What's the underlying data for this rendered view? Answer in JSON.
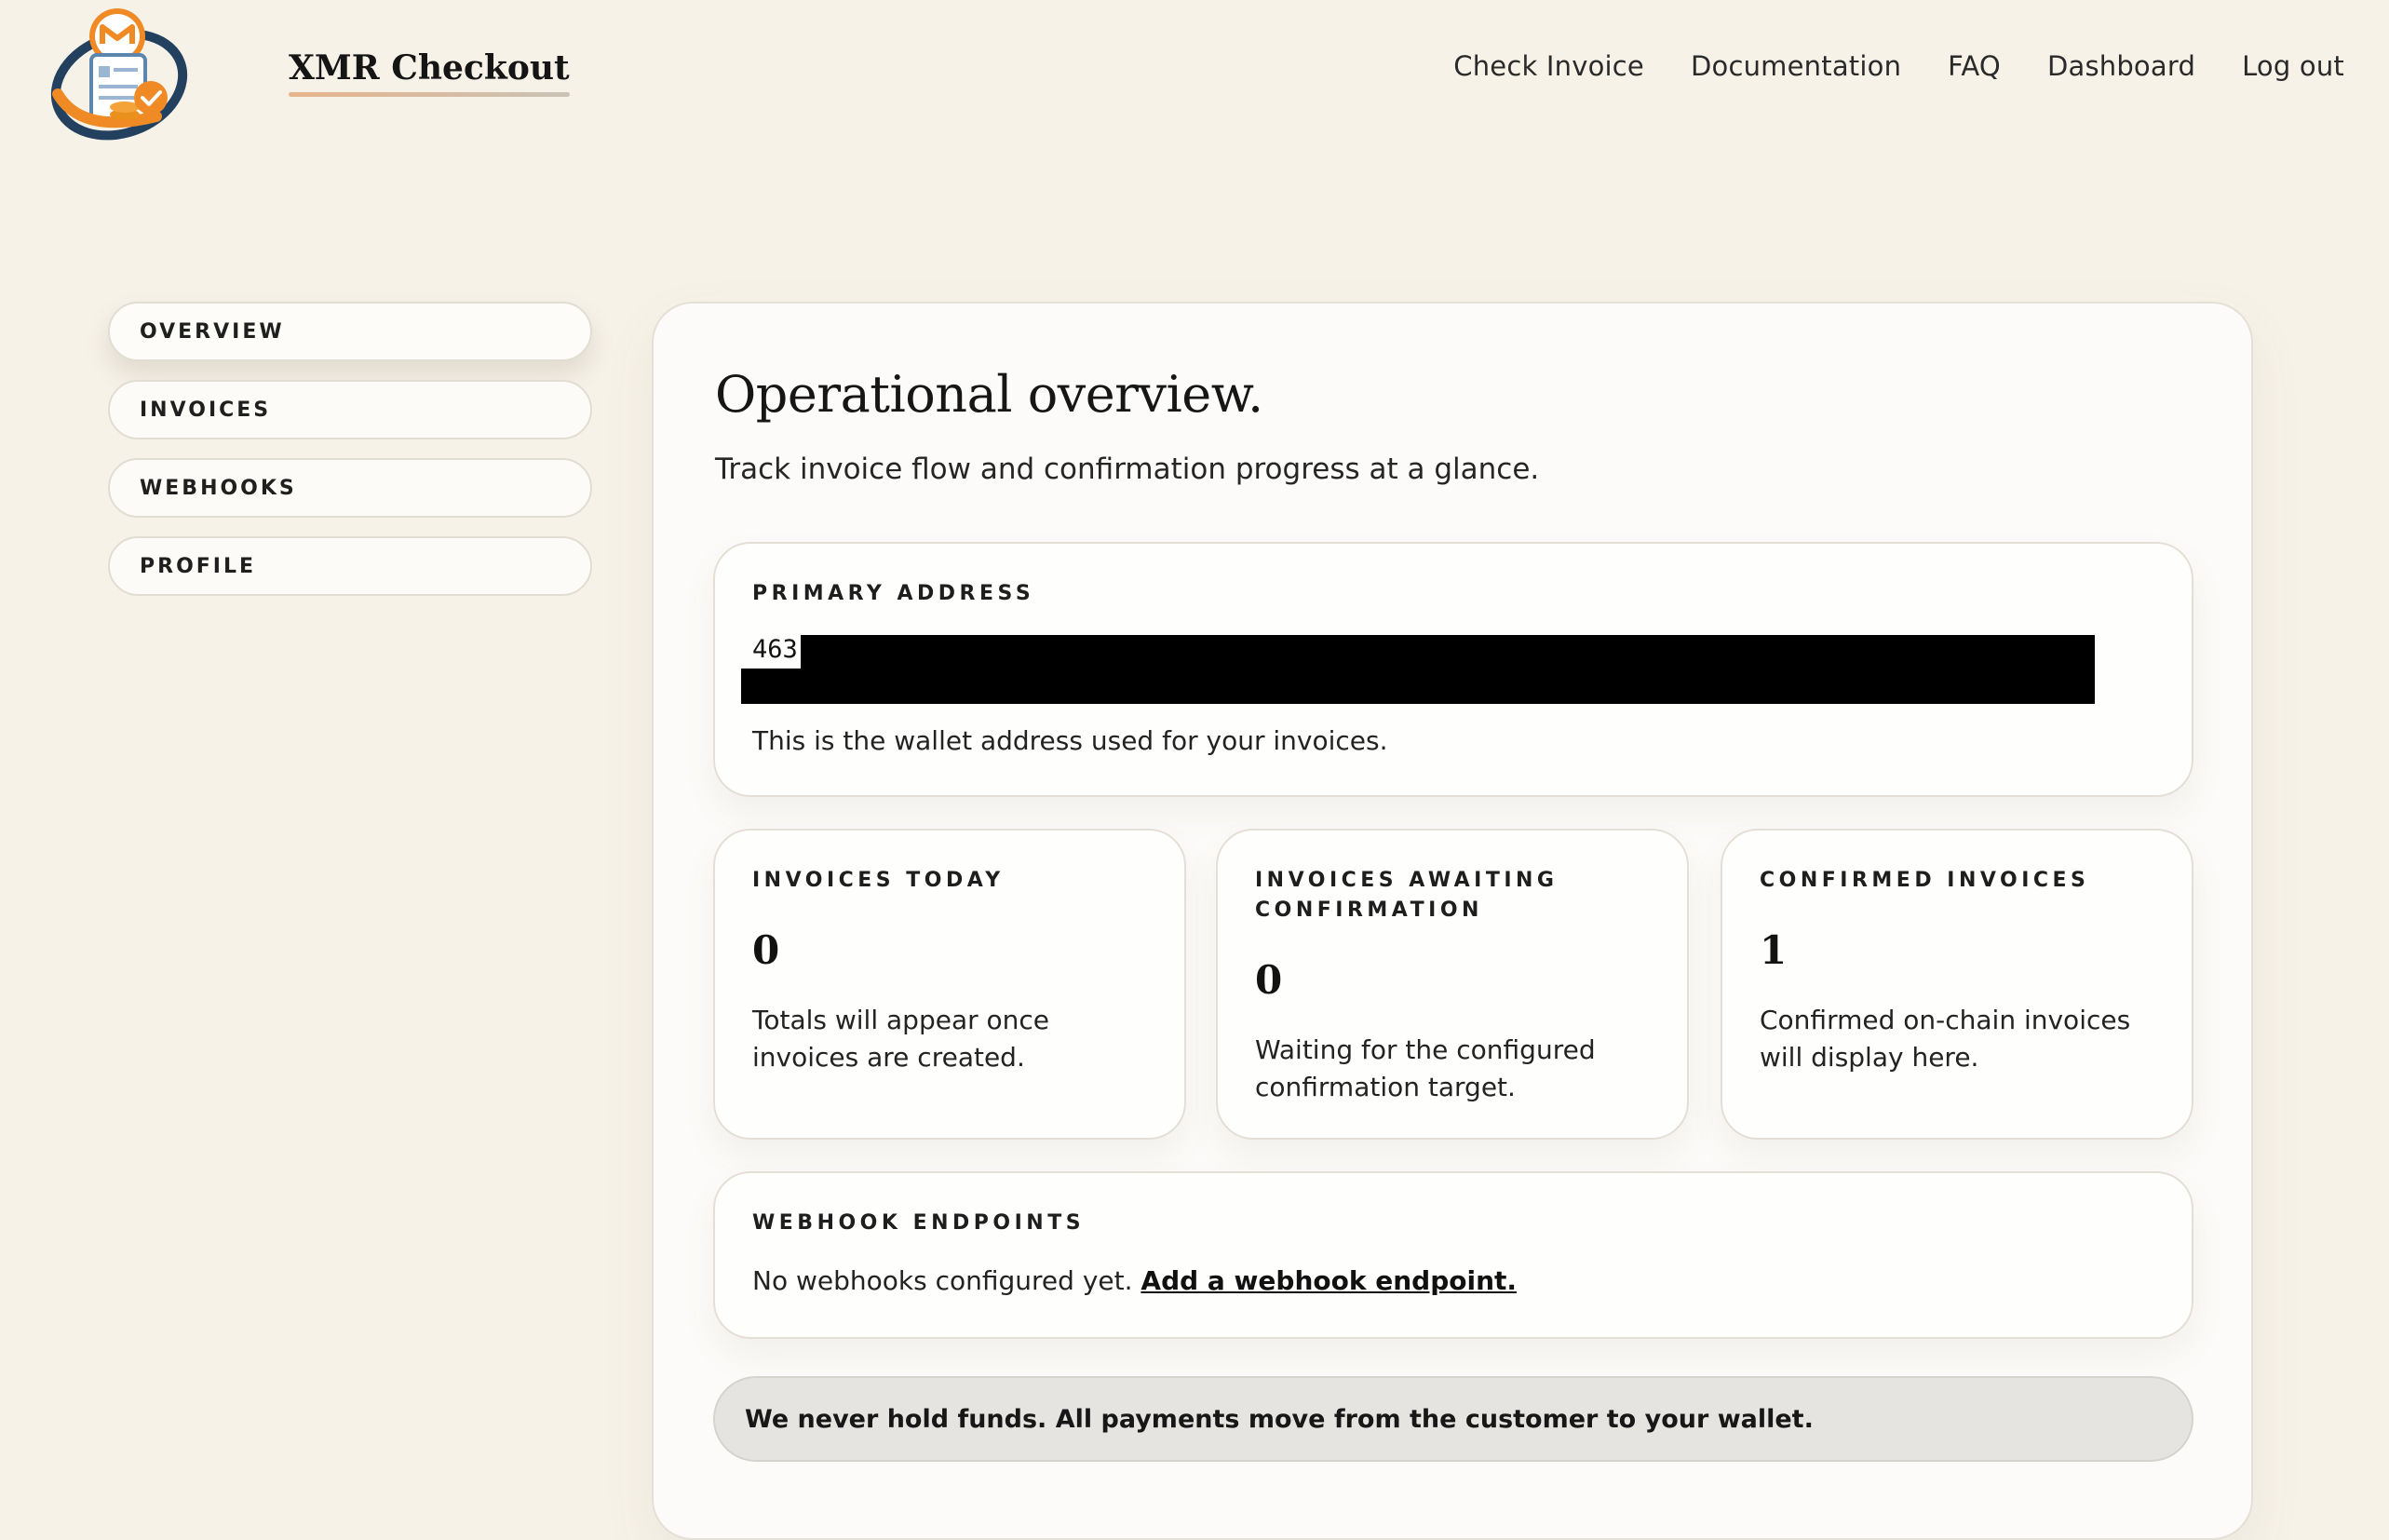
{
  "header": {
    "brand_name": "XMR Checkout",
    "nav": [
      "Check Invoice",
      "Documentation",
      "FAQ",
      "Dashboard",
      "Log out"
    ]
  },
  "sidebar": {
    "items": [
      {
        "label": "OVERVIEW",
        "active": true
      },
      {
        "label": "INVOICES",
        "active": false
      },
      {
        "label": "WEBHOOKS",
        "active": false
      },
      {
        "label": "PROFILE",
        "active": false
      }
    ]
  },
  "main": {
    "title": "Operational overview.",
    "subtitle": "Track invoice flow and confirmation progress at a glance.",
    "primary_address": {
      "label": "PRIMARY ADDRESS",
      "value_visible": "463",
      "redacted": true,
      "hint": "This is the wallet address used for your invoices."
    },
    "stats": [
      {
        "label": "INVOICES TODAY",
        "value": "0",
        "text": "Totals will appear once invoices are created."
      },
      {
        "label": "INVOICES AWAITING CONFIRMATION",
        "value": "0",
        "text": "Waiting for the configured confirmation target."
      },
      {
        "label": "CONFIRMED INVOICES",
        "value": "1",
        "text": "Confirmed on-chain invoices will display here."
      }
    ],
    "webhooks": {
      "label": "WEBHOOK ENDPOINTS",
      "text": "No webhooks configured yet.",
      "link": "Add a webhook endpoint."
    },
    "notice": "We never hold funds. All payments move from the customer to your wallet."
  },
  "colors": {
    "background": "#f6f2e8",
    "panel": "#fcfbf9",
    "accent_orange": "#f08a24",
    "monero_navy": "#23415f"
  }
}
